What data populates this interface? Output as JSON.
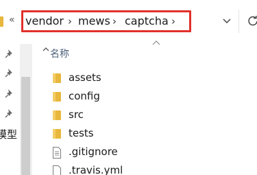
{
  "address_bar": {
    "back_chevrons": "«",
    "crumbs": [
      {
        "label": "vendor",
        "sep": "›"
      },
      {
        "label": "mews",
        "sep": "›"
      },
      {
        "label": "captcha",
        "sep": "›"
      }
    ],
    "highlight_color": "#e0302b"
  },
  "nav_pane": {
    "truncated_item_label": "模型"
  },
  "file_list": {
    "column_name": "名称",
    "items": [
      {
        "name": "assets",
        "type": "folder"
      },
      {
        "name": "config",
        "type": "folder"
      },
      {
        "name": "src",
        "type": "folder"
      },
      {
        "name": "tests",
        "type": "folder"
      },
      {
        "name": ".gitignore",
        "type": "file"
      },
      {
        "name": ".travis.yml",
        "type": "file"
      }
    ]
  },
  "colors": {
    "folder": "#e8b73d",
    "column_header": "#4c607a"
  }
}
